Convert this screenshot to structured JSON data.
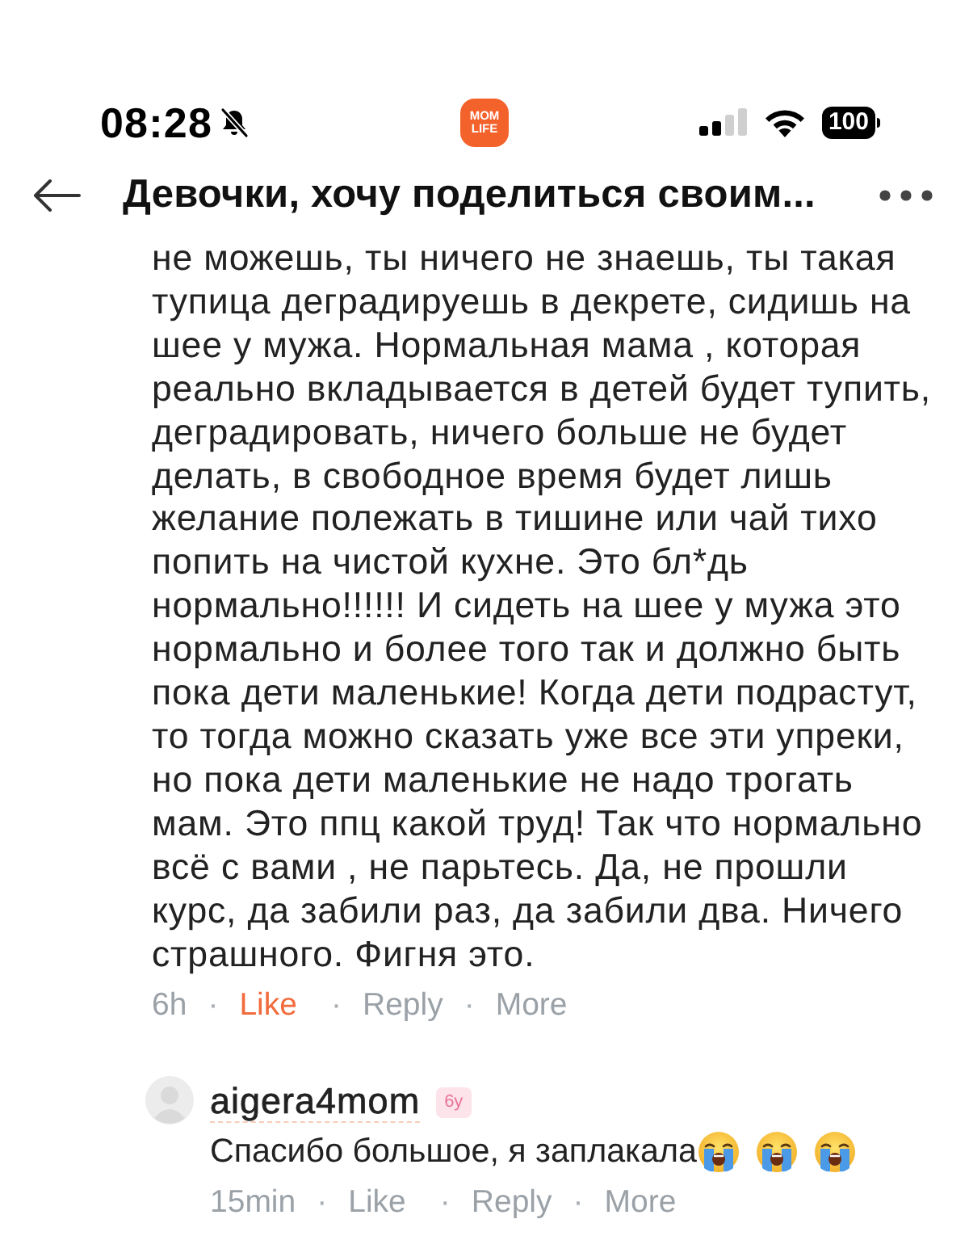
{
  "status_bar": {
    "time": "08:28",
    "silent": true,
    "app_logo": [
      "MOM",
      "LIFE"
    ],
    "battery": "100"
  },
  "header": {
    "title": "Девочки, хочу поделиться своим..."
  },
  "comment": {
    "text_lines": [
      "не можешь, ты ничего не знаешь, ты такая",
      "тупица деградируешь в декрете, сидишь на",
      "шее у мужа. Нормальная мама , которая",
      "реально вкладывается в детей будет тупить,",
      "деградировать, ничего больше не будет",
      "делать, в свободное время будет лишь",
      "желание полежать в тишине или чай тихо",
      "попить на чистой кухне. Это бл*дь",
      "нормально!!!!!! И сидеть на шее у мужа это",
      "нормально и более того так и должно быть",
      "пока дети маленькие! Когда дети подрастут,",
      "то тогда можно сказать уже все эти упреки,",
      "но пока дети маленькие не надо трогать",
      "мам. Это ппц какой труд! Так что нормально",
      "всё с вами , не парьтесь. Да, не прошли",
      "курс, да забили раз, да забили два. Ничего",
      "страшного. Фигня это."
    ],
    "time": "6h",
    "separator": "·",
    "actions": [
      {
        "label": "Like",
        "liked": true
      },
      {
        "label": "Reply"
      },
      {
        "label": "More"
      }
    ]
  },
  "replies": [
    {
      "username": "aigera4mom",
      "badge": "6y",
      "text": "Спасибо большое, я заплакала",
      "time": "15min",
      "separator": "·",
      "actions": [
        {
          "label": "Like",
          "liked": false
        },
        {
          "label": "Reply"
        },
        {
          "label": "More"
        }
      ]
    }
  ]
}
